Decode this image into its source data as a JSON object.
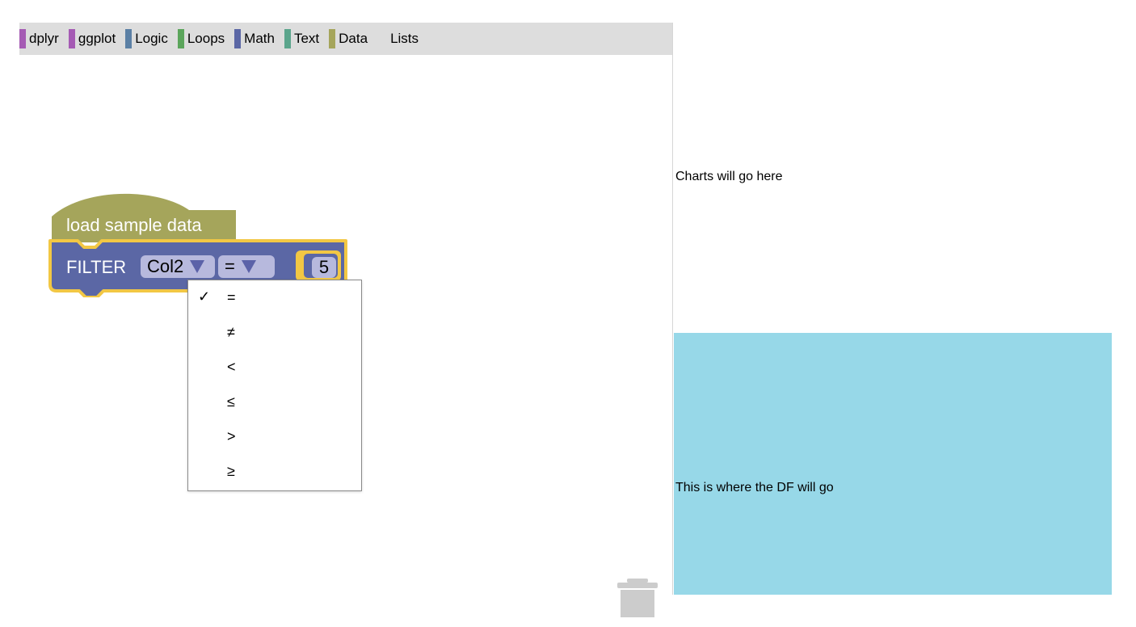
{
  "toolbox": {
    "categories": [
      {
        "label": "dplyr",
        "color": "#a55bb4"
      },
      {
        "label": "ggplot",
        "color": "#a55bb4"
      },
      {
        "label": "Logic",
        "color": "#5b80a5"
      },
      {
        "label": "Loops",
        "color": "#5ba55b"
      },
      {
        "label": "Math",
        "color": "#5b67a5"
      },
      {
        "label": "Text",
        "color": "#5ba58c"
      },
      {
        "label": "Data",
        "color": "#a5a55b"
      },
      {
        "label": "Lists",
        "color": ""
      }
    ]
  },
  "blocks": {
    "load": {
      "label": "load sample data",
      "color": "#a5a55b"
    },
    "filter": {
      "label": "FILTER",
      "column": "Col2",
      "operator": "=",
      "value": "5",
      "color": "#5b67a5",
      "highlight": "#f2c744"
    }
  },
  "dropdown": {
    "selected_index": 0,
    "check_mark": "✓",
    "options": [
      "=",
      "≠",
      "<",
      "≤",
      ">",
      "≥"
    ]
  },
  "icons": {
    "trash": "trash-icon"
  },
  "right_panel": {
    "charts_placeholder": "Charts will go here",
    "df_placeholder": "This is where the DF will go",
    "df_bg": "#97d8e8"
  }
}
